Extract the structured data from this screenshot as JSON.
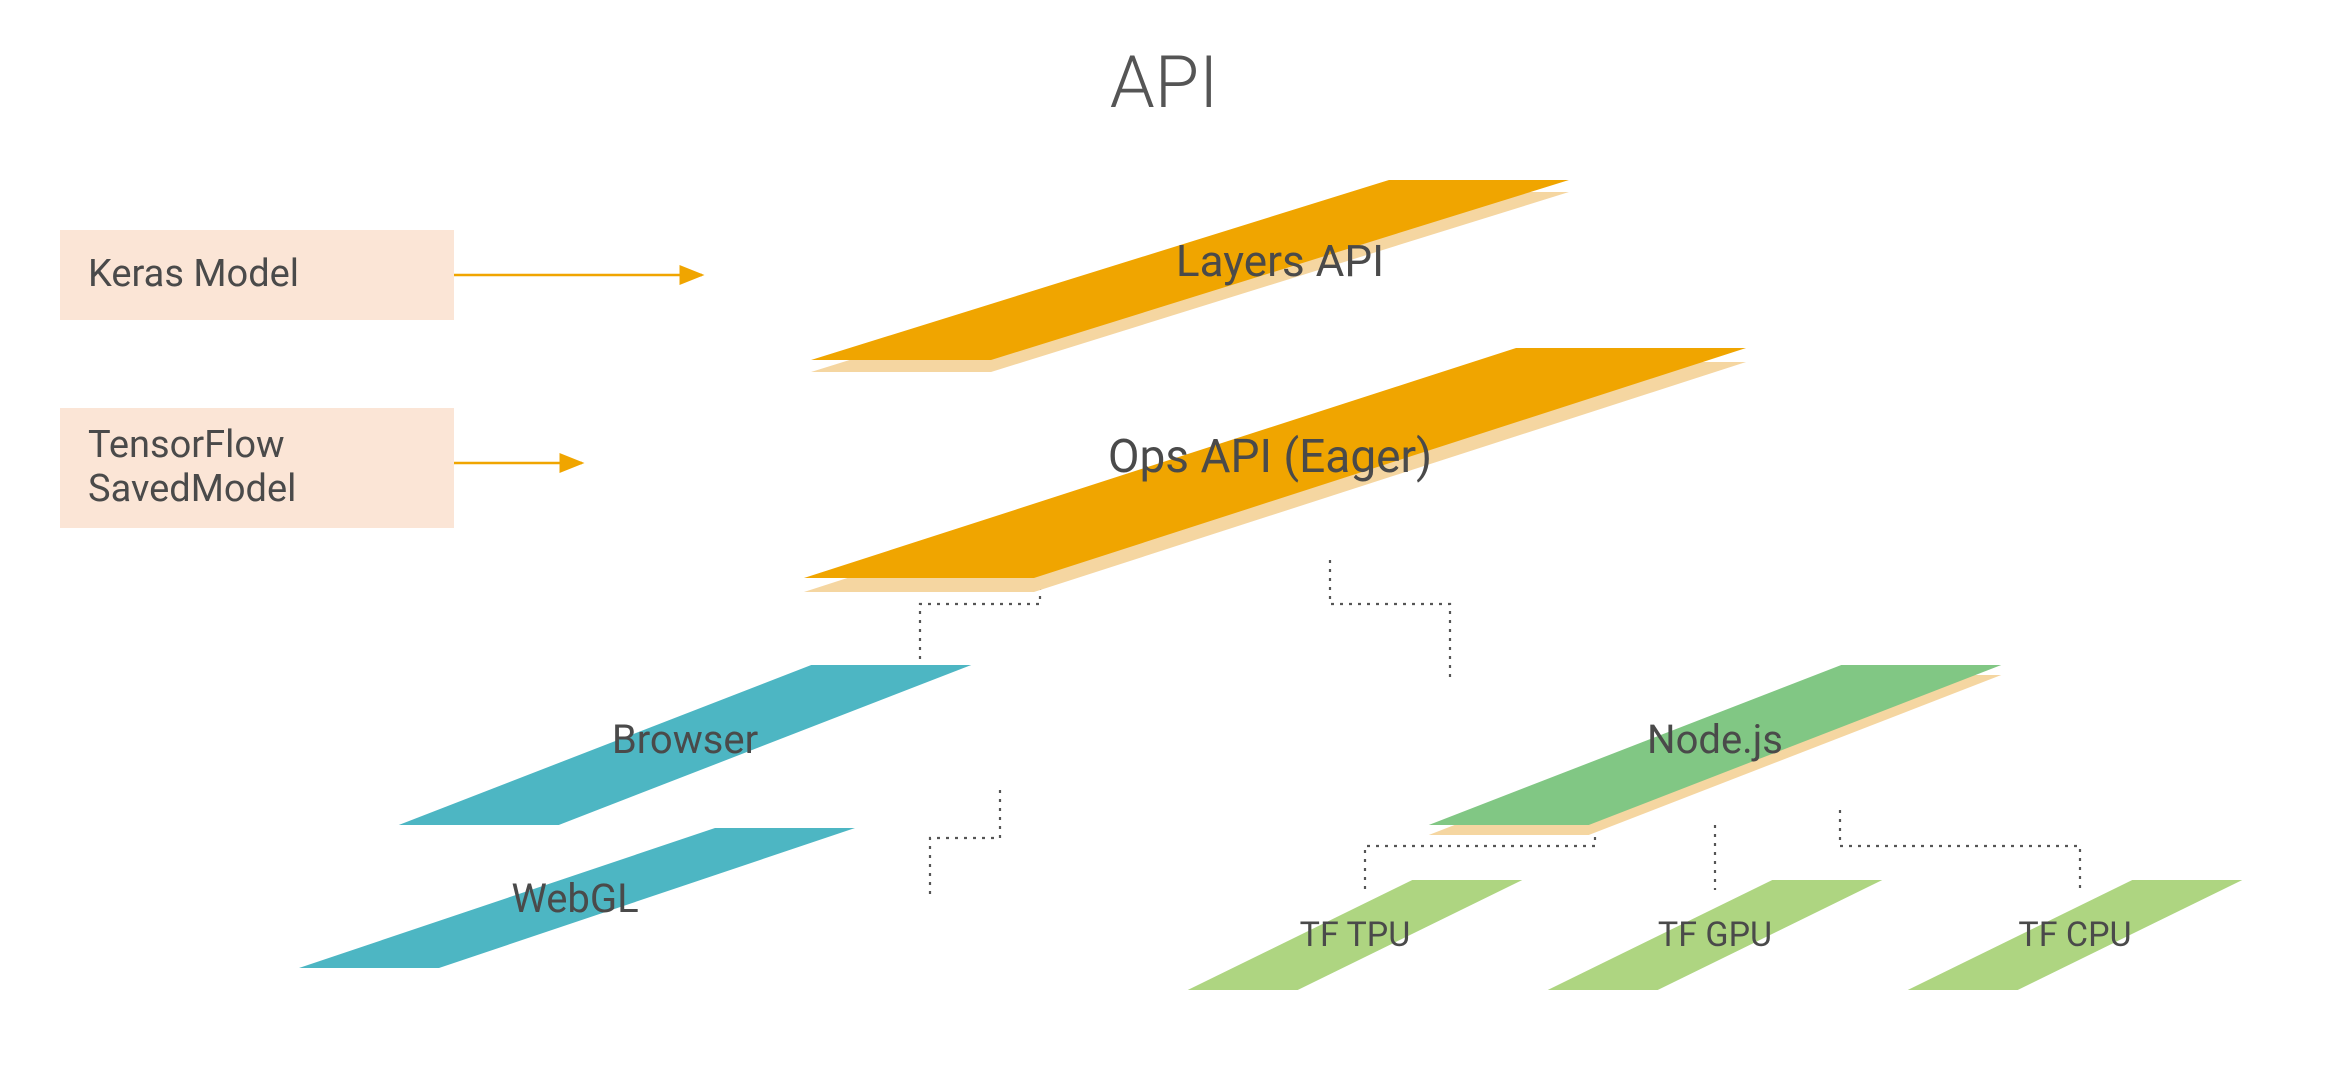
{
  "title": "API",
  "inputs": {
    "keras": "Keras Model",
    "savedmodel_line1": "TensorFlow",
    "savedmodel_line2": "SavedModel"
  },
  "api": {
    "layers": "Layers API",
    "ops": "Ops API (Eager)"
  },
  "backends": {
    "browser": "Browser",
    "webgl": "WebGL",
    "node": "Node.js",
    "tf_tpu": "TF TPU",
    "tf_gpu": "TF GPU",
    "tf_cpu": "TF CPU"
  },
  "colors": {
    "orange": "#f0a500",
    "orange_shadow": "#f5d6a1",
    "peach_box": "#fbe5d6",
    "teal": "#4db6c3",
    "green": "#81c784",
    "green_light": "#aed581",
    "arrow": "#f0a500",
    "dotted": "#555555",
    "text": "#4a4a4a"
  }
}
